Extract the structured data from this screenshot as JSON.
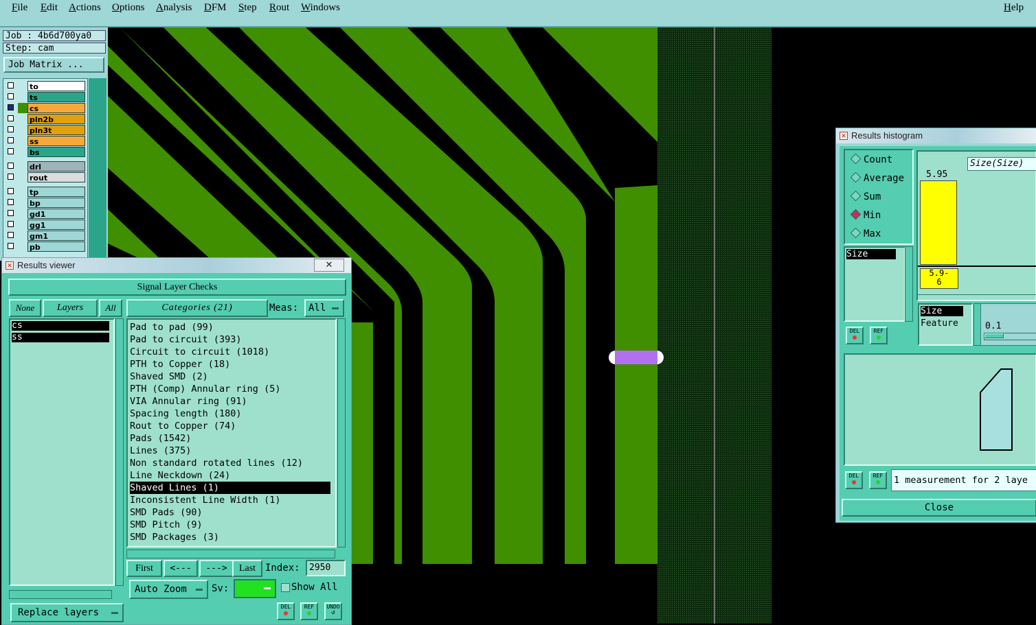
{
  "menubar": {
    "items": [
      "File",
      "Edit",
      "Actions",
      "Options",
      "Analysis",
      "DFM",
      "Step",
      "Rout",
      "Windows"
    ],
    "help": "Help"
  },
  "job": {
    "job_label": "Job : 4b6d700ya0",
    "step_label": "Step: cam",
    "matrix_button": "Job Matrix ..."
  },
  "layers": [
    {
      "name": "to",
      "color": "#ffffff"
    },
    {
      "name": "ts",
      "color": "#2aa58a"
    },
    {
      "name": "cs",
      "color": "#f4a93a"
    },
    {
      "name": "pln2b",
      "color": "#e0a010"
    },
    {
      "name": "pln3t",
      "color": "#e0a010"
    },
    {
      "name": "ss",
      "color": "#f4a93a"
    },
    {
      "name": "bs",
      "color": "#2aa58a"
    },
    {
      "name": "drl",
      "color": "#9fb4b8"
    },
    {
      "name": "rout",
      "color": "#dcdcdc"
    },
    {
      "name": "tp",
      "color": "#9fd6d6"
    },
    {
      "name": "bp",
      "color": "#9fd6d6"
    },
    {
      "name": "gd1",
      "color": "#9fd6d6"
    },
    {
      "name": "gg1",
      "color": "#9fd6d6"
    },
    {
      "name": "gm1",
      "color": "#9fd6d6"
    },
    {
      "name": "pb",
      "color": "#9fd6d6"
    }
  ],
  "results_viewer": {
    "title": "Results viewer",
    "close_glyph": "✕",
    "header": "Signal Layer Checks",
    "none_btn": "None",
    "layers_btn": "Layers",
    "all_btn": "All",
    "categories_btn": "Categories (21)",
    "meas_label": "Meas:",
    "meas_value": "All",
    "layer_list": [
      "cs",
      "ss"
    ],
    "categories": [
      "Pad to pad (99)",
      "Pad to circuit (393)",
      "Circuit to circuit (1018)",
      "PTH to Copper (18)",
      "Shaved SMD (2)",
      "PTH (Comp) Annular ring (5)",
      "VIA Annular ring (91)",
      "Spacing length (180)",
      "Rout to Copper (74)",
      "Pads (1542)",
      "Lines (375)",
      "Non standard rotated lines (12)",
      "Line Neckdown (24)",
      "Shaved Lines (1)",
      "Inconsistent Line Width (1)",
      "SMD Pads (90)",
      "SMD Pitch (9)",
      "SMD Packages (3)"
    ],
    "selected_index": 13,
    "first_btn": "First",
    "prev_btn": "<---",
    "next_btn": "--->",
    "last_btn": "Last",
    "index_label": "Index:",
    "index_value": "2950",
    "autozoom": "Auto Zoom",
    "sv_label": "Sv:",
    "show_all": "Show All",
    "replace_layers": "Replace layers",
    "del": "DEL",
    "ref": "REF",
    "undo": "UNDO"
  },
  "histogram": {
    "title": "Results histogram",
    "modes": [
      "Count",
      "Average",
      "Sum",
      "Min",
      "Max"
    ],
    "selected_mode": "Min",
    "size_item": "Size",
    "size_header": "Size(Size)",
    "bar_value": "5.95",
    "bar_label_line1": "5.9-",
    "bar_label_line2": "6",
    "list_items": [
      "Size",
      "Feature"
    ],
    "slider_value": "0.1",
    "status": "1 measurement for 2 laye",
    "close": "Close",
    "del": "DEL",
    "ref": "REF"
  },
  "colors": {
    "panel": "#9fd6d6",
    "dialog": "#54cdb0",
    "trace": "#3f8f00",
    "highlight": "#b070f0"
  }
}
